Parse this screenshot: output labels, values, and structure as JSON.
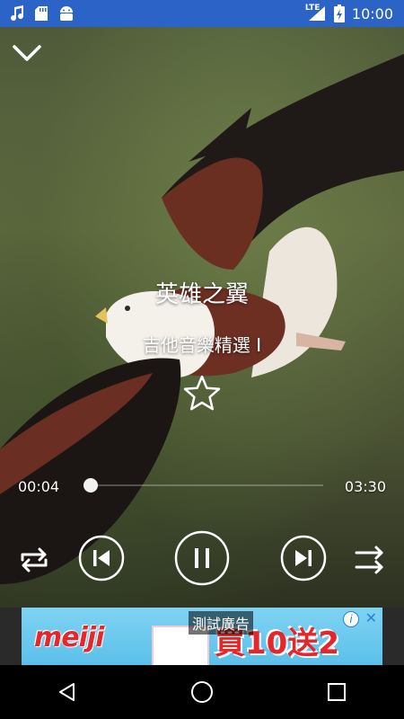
{
  "status_bar": {
    "icons": [
      "music-note-icon",
      "sd-card-icon",
      "android-icon"
    ],
    "network": "LTE",
    "battery_icon": "battery-charging-icon",
    "time": "10:00",
    "color": "#2B63C6"
  },
  "player": {
    "collapse_icon": "chevron-down-icon",
    "song_title": "英雄之翼",
    "album": "吉他音樂精選 I",
    "favorite_icon": "star-outline-icon",
    "current_time": "00:04",
    "total_time": "03:30",
    "progress": 0.02,
    "controls": {
      "repeat_icon": "repeat-icon",
      "previous_icon": "skip-previous-icon",
      "play_pause_icon": "pause-icon",
      "next_icon": "skip-next-icon",
      "shuffle_icon": "shuffle-icon"
    }
  },
  "ad": {
    "brand": "meiji",
    "promo": "買10送2",
    "label": "測試廣告",
    "info_icon": "info-icon",
    "close_icon": "close-icon"
  },
  "nav_bar": {
    "back_icon": "back-triangle-icon",
    "home_icon": "home-circle-icon",
    "recents_icon": "recents-square-icon"
  }
}
